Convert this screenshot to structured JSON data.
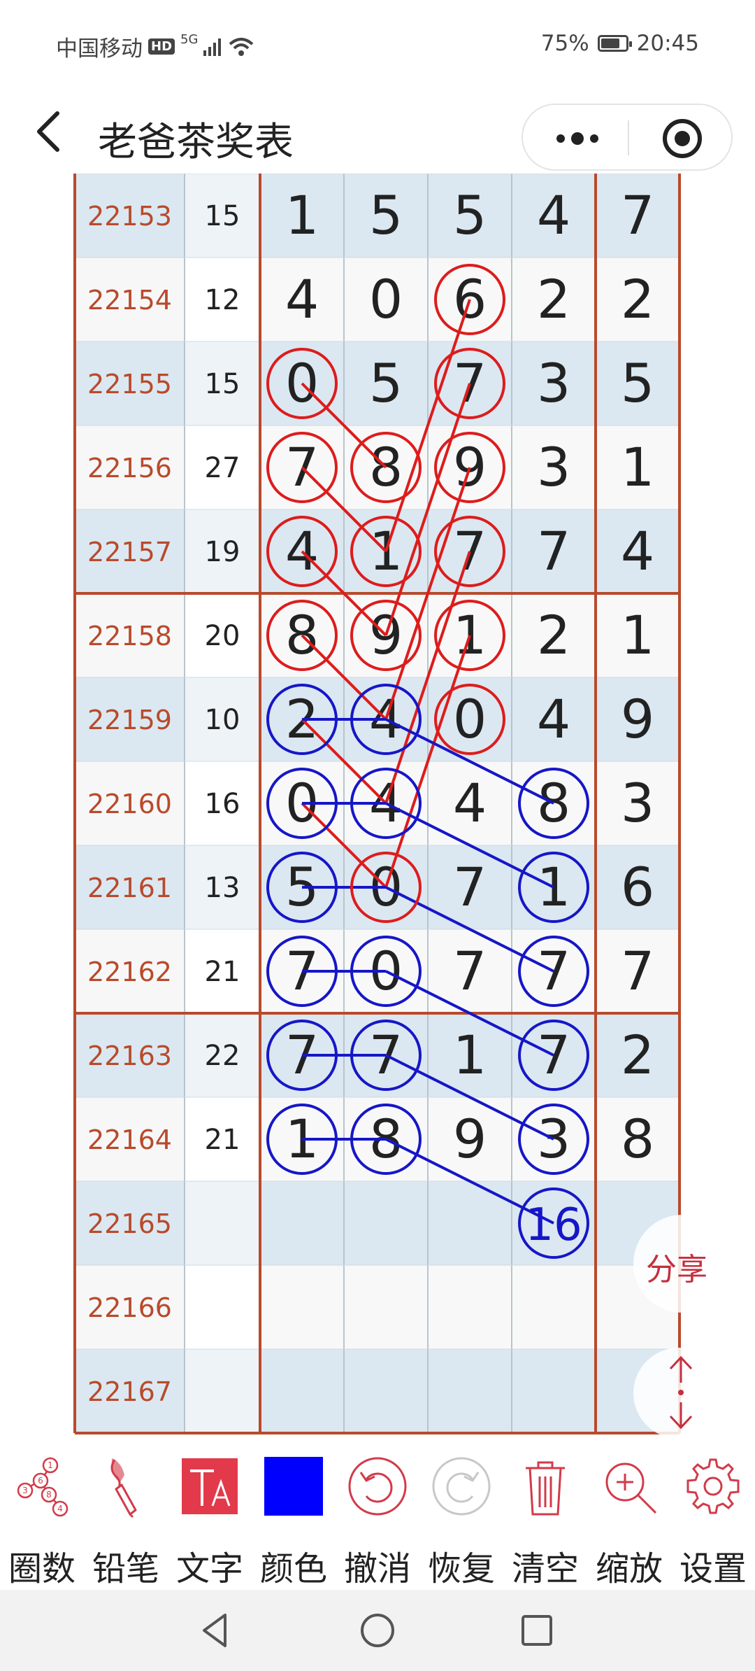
{
  "status_bar": {
    "carrier": "中国移动",
    "hd_badge": "HD",
    "network": "5G",
    "battery": "75%",
    "time": "20:45"
  },
  "header": {
    "title": "老爸茶奖表"
  },
  "colors": {
    "period_text": "#b84a2c",
    "grid_line": "#b84a2c",
    "circle_red": "#dd1c1c",
    "circle_blue": "#1616c8",
    "row_shade": "#dbe8f1",
    "accent": "#d23b4a"
  },
  "table": {
    "rows": [
      {
        "period": "22153",
        "sum": "15",
        "digits": [
          "1",
          "5",
          "5",
          "4"
        ],
        "last": "7"
      },
      {
        "period": "22154",
        "sum": "12",
        "digits": [
          "4",
          "0",
          "6",
          "2"
        ],
        "last": "2"
      },
      {
        "period": "22155",
        "sum": "15",
        "digits": [
          "0",
          "5",
          "7",
          "3"
        ],
        "last": "5"
      },
      {
        "period": "22156",
        "sum": "27",
        "digits": [
          "7",
          "8",
          "9",
          "3"
        ],
        "last": "1"
      },
      {
        "period": "22157",
        "sum": "19",
        "digits": [
          "4",
          "1",
          "7",
          "7"
        ],
        "last": "4"
      },
      {
        "period": "22158",
        "sum": "20",
        "digits": [
          "8",
          "9",
          "1",
          "2"
        ],
        "last": "1"
      },
      {
        "period": "22159",
        "sum": "10",
        "digits": [
          "2",
          "4",
          "0",
          "4"
        ],
        "last": "9"
      },
      {
        "period": "22160",
        "sum": "16",
        "digits": [
          "0",
          "4",
          "4",
          "8"
        ],
        "last": "3"
      },
      {
        "period": "22161",
        "sum": "13",
        "digits": [
          "5",
          "0",
          "7",
          "1"
        ],
        "last": "6"
      },
      {
        "period": "22162",
        "sum": "21",
        "digits": [
          "7",
          "0",
          "7",
          "7"
        ],
        "last": "7"
      },
      {
        "period": "22163",
        "sum": "22",
        "digits": [
          "7",
          "7",
          "1",
          "7"
        ],
        "last": "2"
      },
      {
        "period": "22164",
        "sum": "21",
        "digits": [
          "1",
          "8",
          "9",
          "3"
        ],
        "last": "8"
      },
      {
        "period": "22165",
        "sum": "",
        "digits": [
          "",
          "",
          "",
          ""
        ],
        "last": ""
      },
      {
        "period": "22166",
        "sum": "",
        "digits": [
          "",
          "",
          "",
          ""
        ],
        "last": ""
      },
      {
        "period": "22167",
        "sum": "",
        "digits": [
          "",
          "",
          "",
          ""
        ],
        "last": ""
      }
    ],
    "red_circles": [
      [
        1,
        2
      ],
      [
        2,
        0
      ],
      [
        2,
        2
      ],
      [
        3,
        0
      ],
      [
        3,
        1
      ],
      [
        3,
        2
      ],
      [
        4,
        0
      ],
      [
        4,
        1
      ],
      [
        4,
        2
      ],
      [
        5,
        0
      ],
      [
        5,
        1
      ],
      [
        5,
        2
      ],
      [
        6,
        2
      ],
      [
        8,
        1
      ]
    ],
    "blue_circles": [
      [
        6,
        0
      ],
      [
        6,
        1
      ],
      [
        7,
        0
      ],
      [
        7,
        1
      ],
      [
        7,
        3
      ],
      [
        8,
        0
      ],
      [
        8,
        3
      ],
      [
        9,
        0
      ],
      [
        9,
        1
      ],
      [
        9,
        3
      ],
      [
        10,
        0
      ],
      [
        10,
        1
      ],
      [
        10,
        3
      ],
      [
        11,
        0
      ],
      [
        11,
        1
      ],
      [
        11,
        3
      ]
    ],
    "red_lines": [
      [
        [
          2,
          0
        ],
        [
          3,
          1
        ]
      ],
      [
        [
          3,
          0
        ],
        [
          4,
          1
        ]
      ],
      [
        [
          4,
          0
        ],
        [
          5,
          1
        ]
      ],
      [
        [
          5,
          0
        ],
        [
          6,
          1
        ]
      ],
      [
        [
          6,
          0
        ],
        [
          7,
          1
        ]
      ],
      [
        [
          7,
          0
        ],
        [
          8,
          1
        ]
      ],
      [
        [
          1,
          2
        ],
        [
          4,
          1
        ]
      ],
      [
        [
          2,
          2
        ],
        [
          5,
          1
        ]
      ],
      [
        [
          3,
          2
        ],
        [
          6,
          1
        ]
      ],
      [
        [
          4,
          2
        ],
        [
          7,
          1
        ]
      ],
      [
        [
          5,
          2
        ],
        [
          8,
          1
        ]
      ]
    ],
    "blue_lines": [
      [
        [
          6,
          0
        ],
        [
          6,
          1
        ]
      ],
      [
        [
          7,
          0
        ],
        [
          7,
          1
        ]
      ],
      [
        [
          8,
          0
        ],
        [
          8,
          1
        ]
      ],
      [
        [
          9,
          0
        ],
        [
          9,
          1
        ]
      ],
      [
        [
          10,
          0
        ],
        [
          10,
          1
        ]
      ],
      [
        [
          11,
          0
        ],
        [
          11,
          1
        ]
      ],
      [
        [
          6,
          1
        ],
        [
          7,
          3
        ]
      ],
      [
        [
          7,
          1
        ],
        [
          8,
          3
        ]
      ],
      [
        [
          8,
          1
        ],
        [
          9,
          3
        ]
      ],
      [
        [
          9,
          1
        ],
        [
          10,
          3
        ]
      ],
      [
        [
          10,
          1
        ],
        [
          11,
          3
        ]
      ],
      [
        [
          11,
          1
        ],
        [
          12,
          3
        ]
      ]
    ],
    "annotation": {
      "text": "16",
      "row": 12,
      "col": 3
    }
  },
  "floating": {
    "share_label": "分享"
  },
  "toolbar": {
    "items": [
      {
        "label": "圈数",
        "icon": "circle-numbers-icon"
      },
      {
        "label": "铅笔",
        "icon": "pencil-brush-icon"
      },
      {
        "label": "文字",
        "icon": "text-icon"
      },
      {
        "label": "颜色",
        "icon": "color-swatch-icon"
      },
      {
        "label": "撤消",
        "icon": "undo-icon"
      },
      {
        "label": "恢复",
        "icon": "redo-icon"
      },
      {
        "label": "清空",
        "icon": "trash-icon"
      },
      {
        "label": "缩放",
        "icon": "zoom-in-icon"
      },
      {
        "label": "设置",
        "icon": "gear-icon"
      }
    ],
    "selected_color": "#0000ff"
  }
}
